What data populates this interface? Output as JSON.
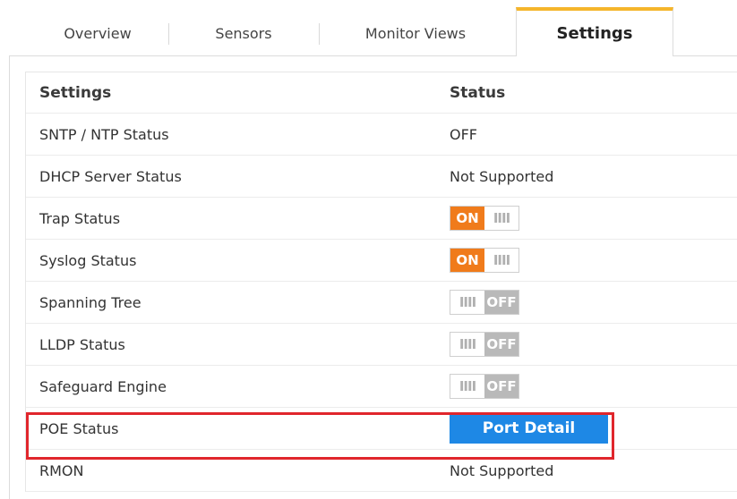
{
  "tabs": [
    {
      "label": "Overview"
    },
    {
      "label": "Sensors"
    },
    {
      "label": "Monitor Views"
    },
    {
      "label": "Settings",
      "active": true
    }
  ],
  "table": {
    "headers": {
      "settings": "Settings",
      "status": "Status"
    },
    "rows": [
      {
        "label": "SNTP / NTP Status",
        "status": "OFF"
      },
      {
        "label": "DHCP Server Status",
        "status": "Not Supported"
      },
      {
        "label": "Trap Status",
        "toggle": "ON"
      },
      {
        "label": "Syslog Status",
        "toggle": "ON"
      },
      {
        "label": "Spanning Tree",
        "toggle": "OFF"
      },
      {
        "label": "LLDP Status",
        "toggle": "OFF"
      },
      {
        "label": "Safeguard Engine",
        "toggle": "OFF"
      },
      {
        "label": "POE Status",
        "button": "Port Detail"
      },
      {
        "label": "RMON",
        "status": "Not Supported"
      }
    ]
  },
  "toggle_text": {
    "on": "ON",
    "off": "OFF",
    "grip": "IIII"
  },
  "colors": {
    "active_tab_accent": "#f5b52b",
    "toggle_on": "#f07b1b",
    "toggle_off": "#b9b9b9",
    "button": "#1e88e5",
    "highlight": "#e0262c"
  }
}
